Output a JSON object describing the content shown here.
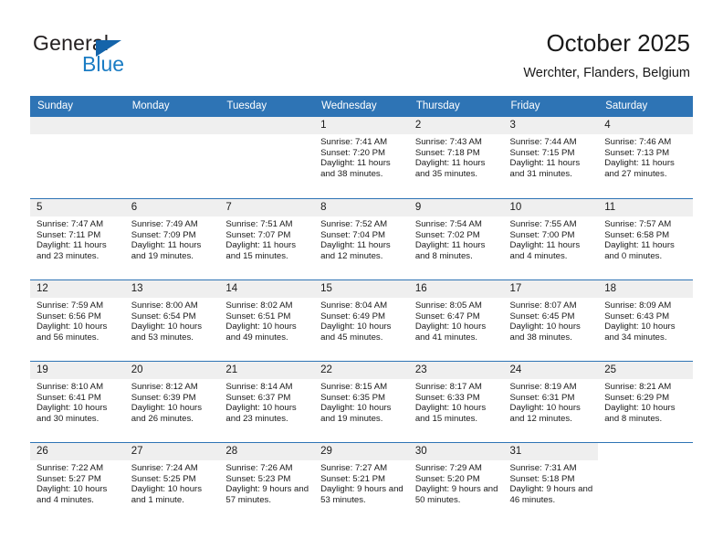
{
  "brand": {
    "name_part1": "General",
    "name_part2": "Blue",
    "logo_icon": "triangle-flag-icon",
    "accent_color": "#1a7cc4"
  },
  "header": {
    "title": "October 2025",
    "subtitle": "Werchter, Flanders, Belgium"
  },
  "calendar": {
    "header_bg": "#2e74b5",
    "date_band_bg": "#efefef",
    "weekday_headers": [
      "Sunday",
      "Monday",
      "Tuesday",
      "Wednesday",
      "Thursday",
      "Friday",
      "Saturday"
    ],
    "weeks": [
      [
        {
          "day": "",
          "sunrise": "",
          "sunset": "",
          "daylight": "",
          "empty": true
        },
        {
          "day": "",
          "sunrise": "",
          "sunset": "",
          "daylight": "",
          "empty": true
        },
        {
          "day": "",
          "sunrise": "",
          "sunset": "",
          "daylight": "",
          "empty": true
        },
        {
          "day": "1",
          "sunrise": "Sunrise: 7:41 AM",
          "sunset": "Sunset: 7:20 PM",
          "daylight": "Daylight: 11 hours and 38 minutes."
        },
        {
          "day": "2",
          "sunrise": "Sunrise: 7:43 AM",
          "sunset": "Sunset: 7:18 PM",
          "daylight": "Daylight: 11 hours and 35 minutes."
        },
        {
          "day": "3",
          "sunrise": "Sunrise: 7:44 AM",
          "sunset": "Sunset: 7:15 PM",
          "daylight": "Daylight: 11 hours and 31 minutes."
        },
        {
          "day": "4",
          "sunrise": "Sunrise: 7:46 AM",
          "sunset": "Sunset: 7:13 PM",
          "daylight": "Daylight: 11 hours and 27 minutes."
        }
      ],
      [
        {
          "day": "5",
          "sunrise": "Sunrise: 7:47 AM",
          "sunset": "Sunset: 7:11 PM",
          "daylight": "Daylight: 11 hours and 23 minutes."
        },
        {
          "day": "6",
          "sunrise": "Sunrise: 7:49 AM",
          "sunset": "Sunset: 7:09 PM",
          "daylight": "Daylight: 11 hours and 19 minutes."
        },
        {
          "day": "7",
          "sunrise": "Sunrise: 7:51 AM",
          "sunset": "Sunset: 7:07 PM",
          "daylight": "Daylight: 11 hours and 15 minutes."
        },
        {
          "day": "8",
          "sunrise": "Sunrise: 7:52 AM",
          "sunset": "Sunset: 7:04 PM",
          "daylight": "Daylight: 11 hours and 12 minutes."
        },
        {
          "day": "9",
          "sunrise": "Sunrise: 7:54 AM",
          "sunset": "Sunset: 7:02 PM",
          "daylight": "Daylight: 11 hours and 8 minutes."
        },
        {
          "day": "10",
          "sunrise": "Sunrise: 7:55 AM",
          "sunset": "Sunset: 7:00 PM",
          "daylight": "Daylight: 11 hours and 4 minutes."
        },
        {
          "day": "11",
          "sunrise": "Sunrise: 7:57 AM",
          "sunset": "Sunset: 6:58 PM",
          "daylight": "Daylight: 11 hours and 0 minutes."
        }
      ],
      [
        {
          "day": "12",
          "sunrise": "Sunrise: 7:59 AM",
          "sunset": "Sunset: 6:56 PM",
          "daylight": "Daylight: 10 hours and 56 minutes."
        },
        {
          "day": "13",
          "sunrise": "Sunrise: 8:00 AM",
          "sunset": "Sunset: 6:54 PM",
          "daylight": "Daylight: 10 hours and 53 minutes."
        },
        {
          "day": "14",
          "sunrise": "Sunrise: 8:02 AM",
          "sunset": "Sunset: 6:51 PM",
          "daylight": "Daylight: 10 hours and 49 minutes."
        },
        {
          "day": "15",
          "sunrise": "Sunrise: 8:04 AM",
          "sunset": "Sunset: 6:49 PM",
          "daylight": "Daylight: 10 hours and 45 minutes."
        },
        {
          "day": "16",
          "sunrise": "Sunrise: 8:05 AM",
          "sunset": "Sunset: 6:47 PM",
          "daylight": "Daylight: 10 hours and 41 minutes."
        },
        {
          "day": "17",
          "sunrise": "Sunrise: 8:07 AM",
          "sunset": "Sunset: 6:45 PM",
          "daylight": "Daylight: 10 hours and 38 minutes."
        },
        {
          "day": "18",
          "sunrise": "Sunrise: 8:09 AM",
          "sunset": "Sunset: 6:43 PM",
          "daylight": "Daylight: 10 hours and 34 minutes."
        }
      ],
      [
        {
          "day": "19",
          "sunrise": "Sunrise: 8:10 AM",
          "sunset": "Sunset: 6:41 PM",
          "daylight": "Daylight: 10 hours and 30 minutes."
        },
        {
          "day": "20",
          "sunrise": "Sunrise: 8:12 AM",
          "sunset": "Sunset: 6:39 PM",
          "daylight": "Daylight: 10 hours and 26 minutes."
        },
        {
          "day": "21",
          "sunrise": "Sunrise: 8:14 AM",
          "sunset": "Sunset: 6:37 PM",
          "daylight": "Daylight: 10 hours and 23 minutes."
        },
        {
          "day": "22",
          "sunrise": "Sunrise: 8:15 AM",
          "sunset": "Sunset: 6:35 PM",
          "daylight": "Daylight: 10 hours and 19 minutes."
        },
        {
          "day": "23",
          "sunrise": "Sunrise: 8:17 AM",
          "sunset": "Sunset: 6:33 PM",
          "daylight": "Daylight: 10 hours and 15 minutes."
        },
        {
          "day": "24",
          "sunrise": "Sunrise: 8:19 AM",
          "sunset": "Sunset: 6:31 PM",
          "daylight": "Daylight: 10 hours and 12 minutes."
        },
        {
          "day": "25",
          "sunrise": "Sunrise: 8:21 AM",
          "sunset": "Sunset: 6:29 PM",
          "daylight": "Daylight: 10 hours and 8 minutes."
        }
      ],
      [
        {
          "day": "26",
          "sunrise": "Sunrise: 7:22 AM",
          "sunset": "Sunset: 5:27 PM",
          "daylight": "Daylight: 10 hours and 4 minutes."
        },
        {
          "day": "27",
          "sunrise": "Sunrise: 7:24 AM",
          "sunset": "Sunset: 5:25 PM",
          "daylight": "Daylight: 10 hours and 1 minute."
        },
        {
          "day": "28",
          "sunrise": "Sunrise: 7:26 AM",
          "sunset": "Sunset: 5:23 PM",
          "daylight": "Daylight: 9 hours and 57 minutes."
        },
        {
          "day": "29",
          "sunrise": "Sunrise: 7:27 AM",
          "sunset": "Sunset: 5:21 PM",
          "daylight": "Daylight: 9 hours and 53 minutes."
        },
        {
          "day": "30",
          "sunrise": "Sunrise: 7:29 AM",
          "sunset": "Sunset: 5:20 PM",
          "daylight": "Daylight: 9 hours and 50 minutes."
        },
        {
          "day": "31",
          "sunrise": "Sunrise: 7:31 AM",
          "sunset": "Sunset: 5:18 PM",
          "daylight": "Daylight: 9 hours and 46 minutes."
        },
        {
          "day": "",
          "sunrise": "",
          "sunset": "",
          "daylight": "",
          "blank": true
        }
      ]
    ]
  }
}
